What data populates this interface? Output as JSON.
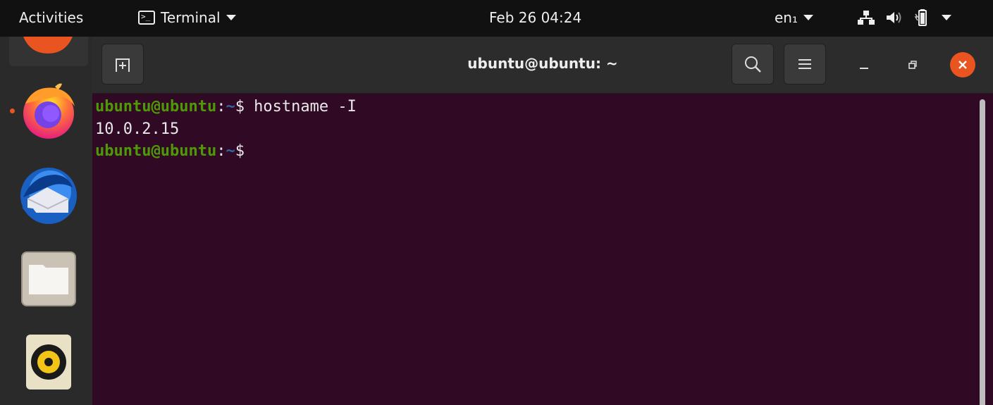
{
  "topbar": {
    "activities": "Activities",
    "app_name": "Terminal",
    "clock": "Feb 26  04:24",
    "lang": "en₁",
    "icons": [
      "network-icon",
      "volume-icon",
      "battery-icon",
      "system-menu-icon"
    ]
  },
  "dock": {
    "items": [
      {
        "name": "ubuntu-software",
        "running": false
      },
      {
        "name": "firefox",
        "running": true
      },
      {
        "name": "thunderbird",
        "running": false
      },
      {
        "name": "files",
        "running": false
      },
      {
        "name": "rhythmbox",
        "running": false
      }
    ]
  },
  "window": {
    "title": "ubuntu@ubuntu: ~",
    "buttons": [
      "new-tab",
      "search",
      "menu",
      "minimize",
      "maximize",
      "close"
    ]
  },
  "terminal": {
    "lines": [
      {
        "user": "ubuntu@ubuntu",
        "sep": ":",
        "path": "~",
        "sym": "$",
        "cmd": " hostname -I"
      },
      {
        "output": "10.0.2.15"
      },
      {
        "user": "ubuntu@ubuntu",
        "sep": ":",
        "path": "~",
        "sym": "$",
        "cmd": ""
      }
    ]
  },
  "colors": {
    "terminal_bg": "#300a24",
    "prompt_user": "#4e9a06",
    "prompt_path": "#3465a4",
    "accent": "#e95420"
  }
}
